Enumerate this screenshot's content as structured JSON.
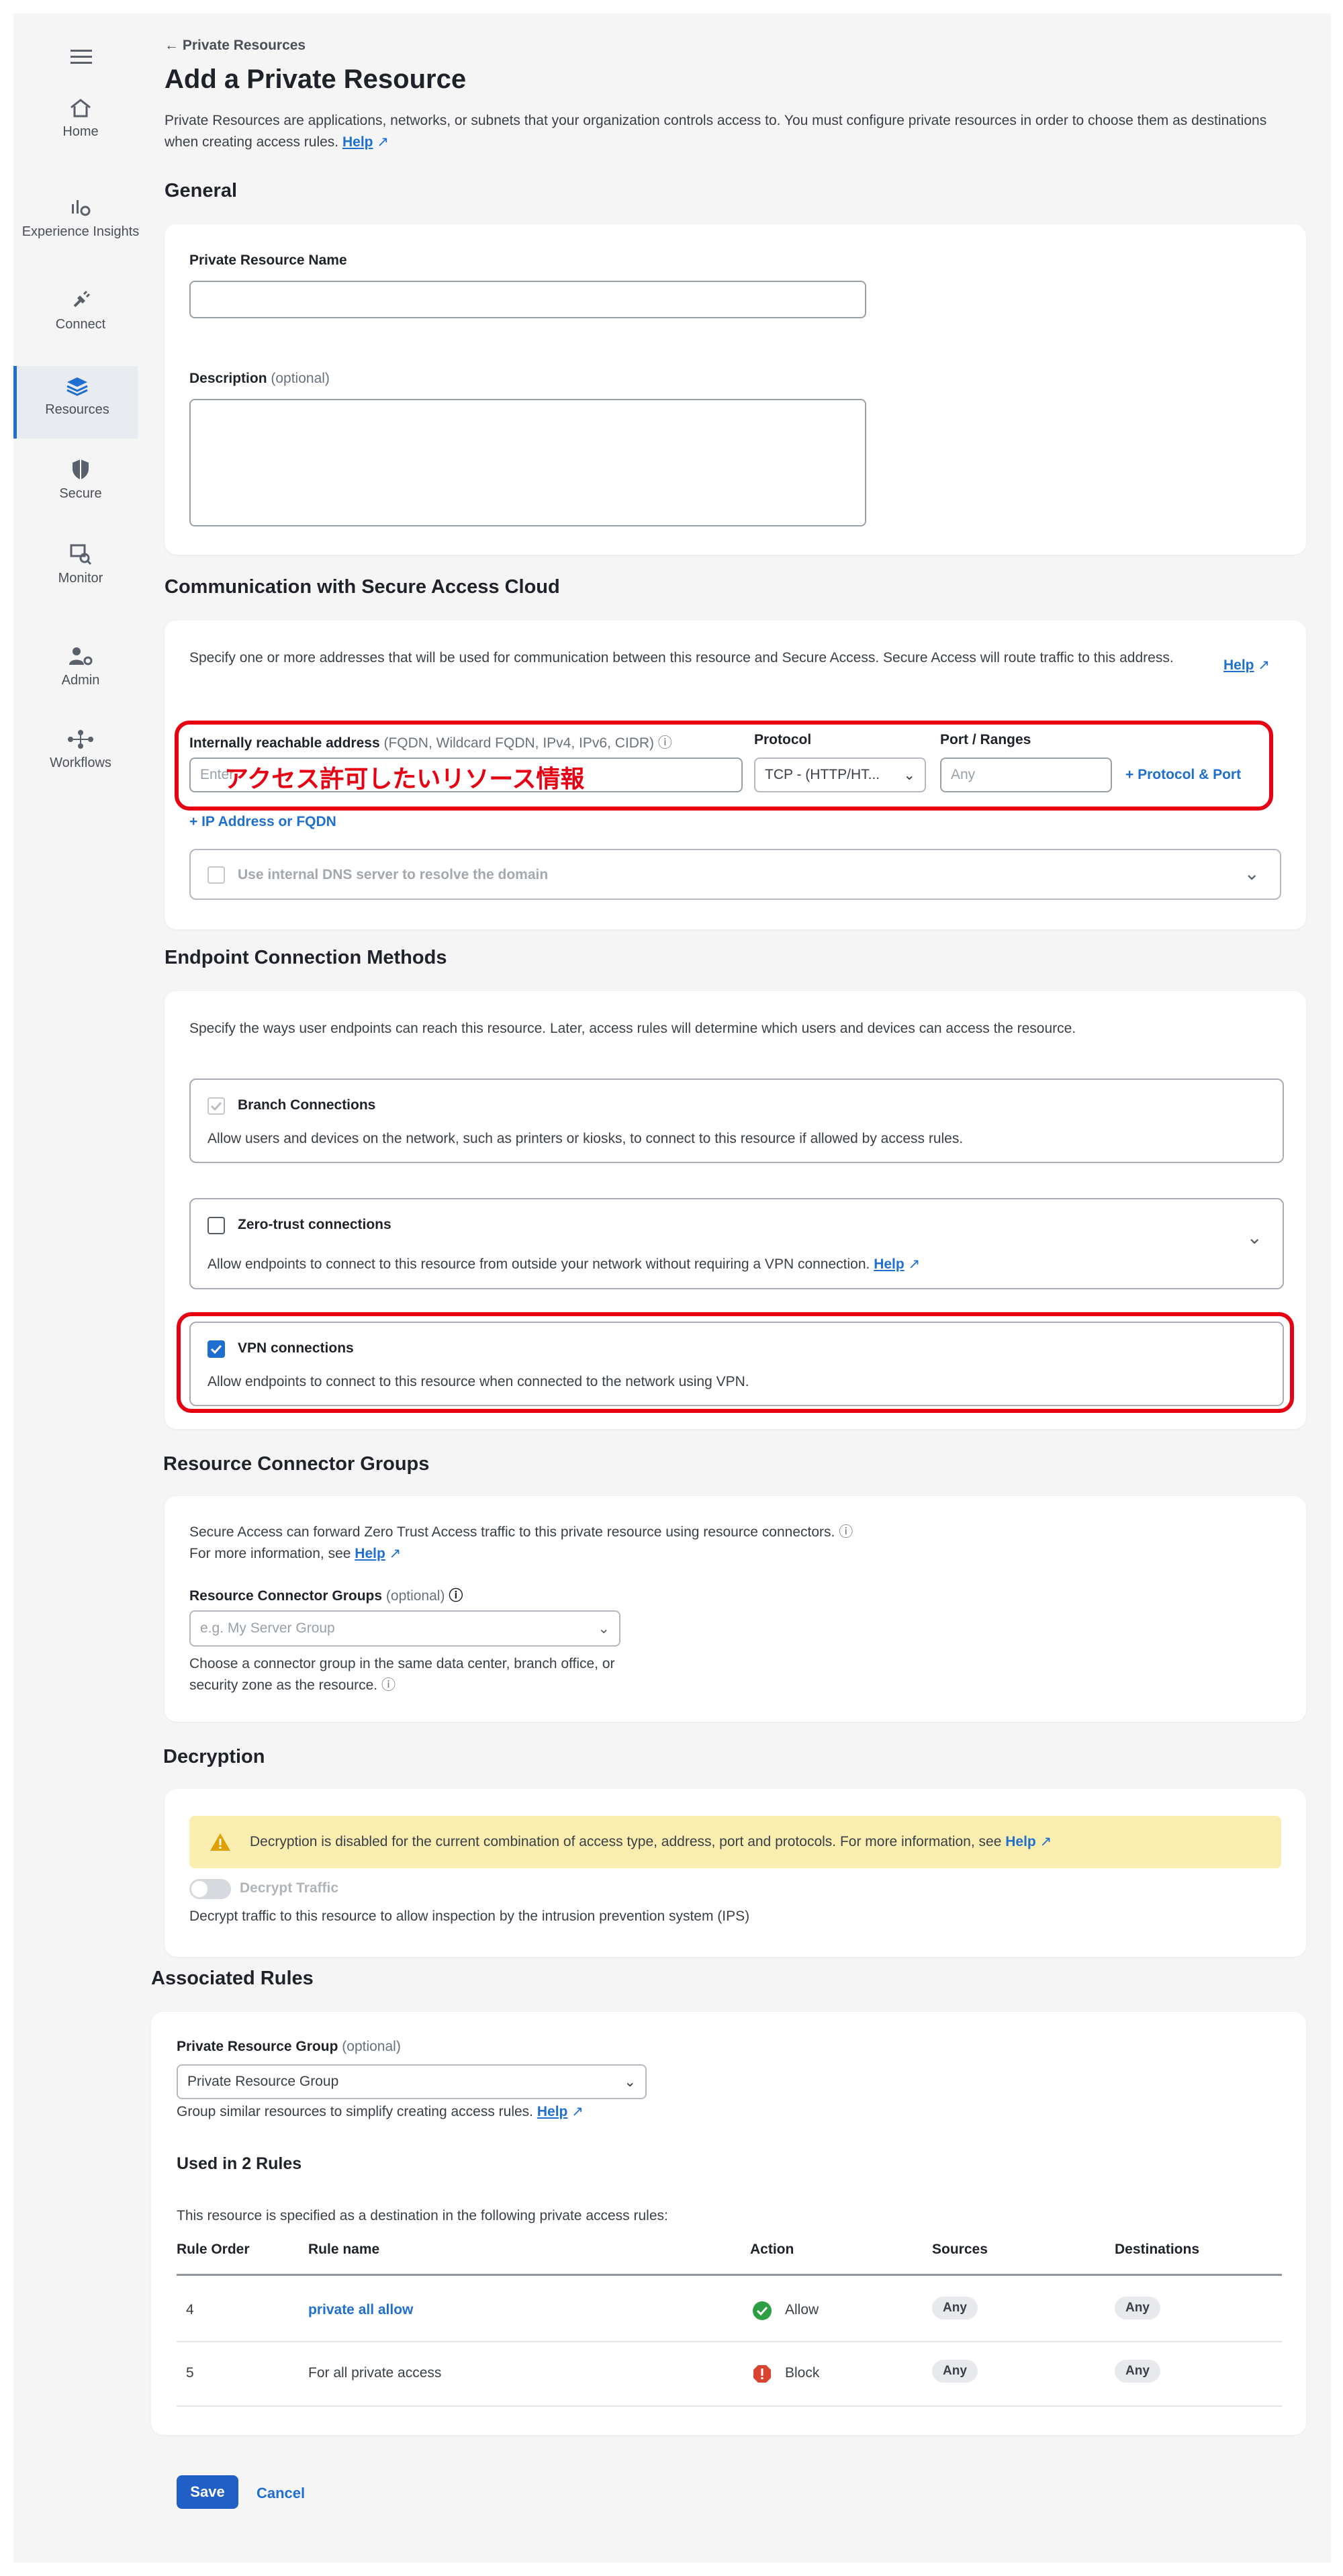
{
  "sidebar": {
    "items": [
      {
        "label": "Home"
      },
      {
        "label": "Experience Insights"
      },
      {
        "label": "Connect"
      },
      {
        "label": "Resources"
      },
      {
        "label": "Secure"
      },
      {
        "label": "Monitor"
      },
      {
        "label": "Admin"
      },
      {
        "label": "Workflows"
      }
    ]
  },
  "header": {
    "breadcrumb": "← Private Resources",
    "title": "Add a Private Resource",
    "intro": "Private Resources are applications, networks, or subnets that your organization controls access to. You must configure private resources in order to choose them as destinations when creating access rules.",
    "help": "Help"
  },
  "general": {
    "heading": "General",
    "name_label": "Private Resource Name",
    "name_value": "",
    "desc_label": "Description",
    "desc_optional": "(optional)",
    "desc_value": ""
  },
  "communication": {
    "heading": "Communication with Secure Access Cloud",
    "intro": "Specify one or more addresses that will be used for communication between this resource and Secure Access. Secure Access will route traffic to this address.",
    "help": "Help",
    "address_label": "Internally reachable address",
    "address_hint": "(FQDN, Wildcard FQDN, IPv4, IPv6, CIDR)",
    "address_placeholder": "Enter",
    "protocol_label": "Protocol",
    "protocol_value": "TCP - (HTTP/HT...",
    "port_label": "Port / Ranges",
    "port_placeholder": "Any",
    "add_protocol": "+ Protocol & Port",
    "add_address": "+ IP Address or FQDN",
    "dns_label": "Use internal DNS server to resolve the domain",
    "annotation": "アクセス許可したいリソース情報"
  },
  "endpoint": {
    "heading": "Endpoint Connection Methods",
    "intro": "Specify the ways user endpoints can reach this resource. Later, access rules will determine which users and devices can access the resource.",
    "branch_title": "Branch Connections",
    "branch_desc": "Allow users and devices on the network, such as printers or kiosks, to connect to this resource if allowed by access rules.",
    "zt_title": "Zero-trust connections",
    "zt_desc": "Allow endpoints to connect to this resource from outside your network without requiring a VPN connection.",
    "zt_help": "Help",
    "vpn_title": "VPN connections",
    "vpn_desc": "Allow endpoints to connect to this resource when connected to the network using VPN."
  },
  "connector": {
    "heading": "Resource Connector Groups",
    "intro": "Secure Access can forward Zero Trust Access traffic to this private resource using resource connectors.",
    "more_info": "For more information, see",
    "help": "Help",
    "label": "Resource Connector Groups",
    "optional": "(optional)",
    "placeholder": "e.g. My Server Group",
    "hint": "Choose a connector group in the same data center, branch office, or security zone as the resource."
  },
  "decryption": {
    "heading": "Decryption",
    "warning": "Decryption is disabled for the current combination of access type, address, port and protocols. For more information, see",
    "help": "Help",
    "toggle_label": "Decrypt Traffic",
    "desc": "Decrypt traffic to this resource to allow inspection by the intrusion prevention system (IPS)"
  },
  "rules": {
    "heading": "Associated Rules",
    "group_label": "Private Resource Group",
    "group_optional": "(optional)",
    "group_value": "Private Resource Group",
    "group_hint": "Group similar resources to simplify creating access rules.",
    "help": "Help",
    "used_in": "Used in 2 Rules",
    "table_intro": "This resource is specified as a destination in the following private access rules:",
    "columns": [
      "Rule Order",
      "Rule name",
      "Action",
      "Sources",
      "Destinations"
    ],
    "rows": [
      {
        "order": "4",
        "name": "private all allow",
        "action": "Allow",
        "sources": "Any",
        "destinations": "Any"
      },
      {
        "order": "5",
        "name": "For all private access",
        "action": "Block",
        "sources": "Any",
        "destinations": "Any"
      }
    ]
  },
  "footer": {
    "save": "Save",
    "cancel": "Cancel"
  },
  "colors": {
    "accent": "#1f6fd1",
    "annotation_red": "#e60012",
    "allow": "#2e9e44",
    "block": "#d9432f",
    "warning_bg": "#f9eeb0"
  }
}
